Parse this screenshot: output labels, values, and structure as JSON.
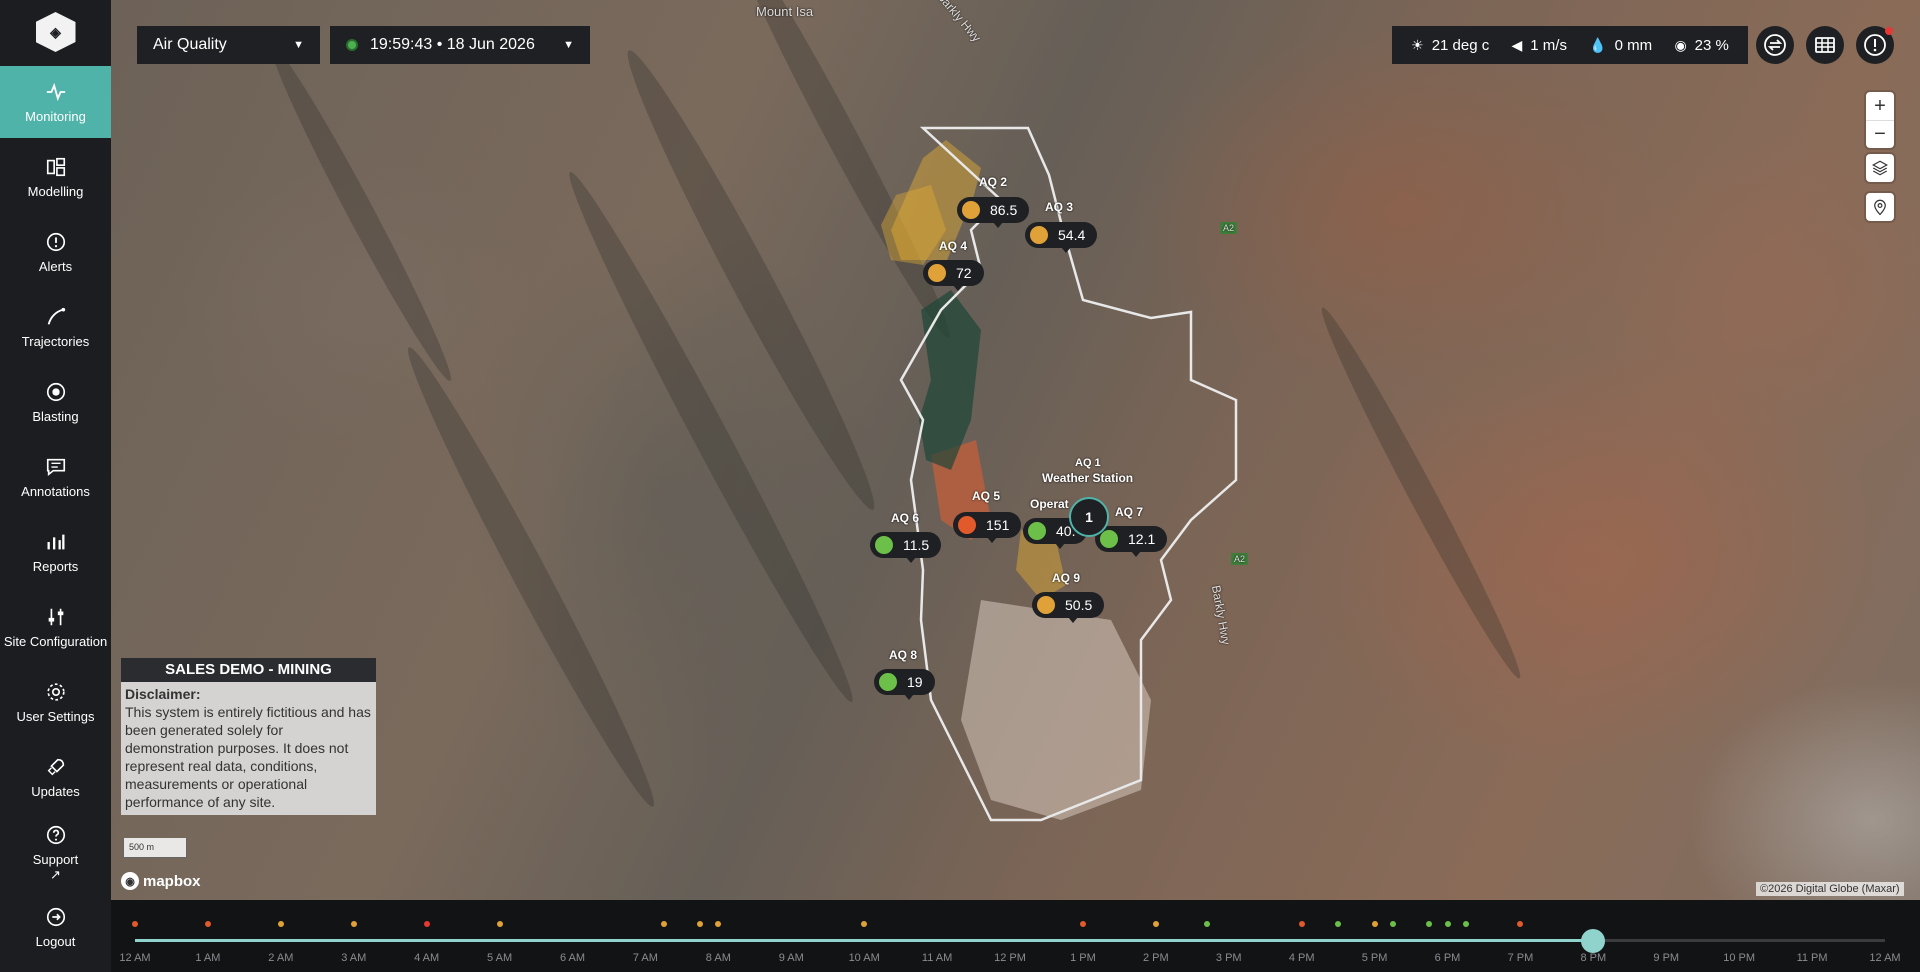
{
  "app": {
    "logo_icon": "pulse-hexagon-icon"
  },
  "sidebar": {
    "items": [
      {
        "label": "Monitoring",
        "icon": "pulse-icon",
        "active": true
      },
      {
        "label": "Modelling",
        "icon": "chart-blocks-icon",
        "active": false
      },
      {
        "label": "Alerts",
        "icon": "alert-circle-icon",
        "active": false
      },
      {
        "label": "Trajectories",
        "icon": "trajectory-icon",
        "active": false
      },
      {
        "label": "Blasting",
        "icon": "target-icon",
        "active": false
      },
      {
        "label": "Annotations",
        "icon": "comment-icon",
        "active": false
      },
      {
        "label": "Reports",
        "icon": "bar-chart-icon",
        "active": false
      },
      {
        "label": "Site Configuration",
        "icon": "sliders-icon",
        "active": false
      },
      {
        "label": "User Settings",
        "icon": "gear-icon",
        "active": false
      },
      {
        "label": "Updates",
        "icon": "rocket-icon",
        "active": false
      },
      {
        "label": "Support",
        "icon": "help-circle-icon",
        "active": false
      },
      {
        "label": "Logout",
        "icon": "logout-icon",
        "active": false
      }
    ]
  },
  "toolbar": {
    "layer_select": "Air Quality",
    "time_select": "19:59:43 • 18 Jun 2026"
  },
  "weather": {
    "temperature": "21 deg c",
    "wind": "1 m/s",
    "rain": "0 mm",
    "humidity": "23 %"
  },
  "map": {
    "place_labels": [
      "Mount Isa",
      "Barkly Hwy",
      "Barkly Hwy"
    ],
    "road_signs": [
      "A2",
      "A2"
    ],
    "sensors": [
      {
        "name": "AQ 2",
        "value": "86.5",
        "status_color": "#e0a238"
      },
      {
        "name": "AQ 3",
        "value": "54.4",
        "status_color": "#e0a238"
      },
      {
        "name": "AQ 4",
        "value": "72",
        "status_color": "#e0a238"
      },
      {
        "name": "AQ 5",
        "value": "151",
        "status_color": "#e25a2c"
      },
      {
        "name": "AQ 6",
        "value": "11.5",
        "status_color": "#6cc04a"
      },
      {
        "name": "Operat",
        "value": "40.",
        "status_color": "#6cc04a"
      },
      {
        "name": "AQ 7",
        "value": "12.1",
        "status_color": "#6cc04a"
      },
      {
        "name": "AQ 9",
        "value": "50.5",
        "status_color": "#e0a238"
      },
      {
        "name": "AQ 8",
        "value": "19",
        "status_color": "#6cc04a"
      }
    ],
    "weather_station": {
      "name": "Weather Station",
      "cluster_count": "1",
      "hidden_label": "AQ 1"
    },
    "scale": "500 m",
    "attribution": "©2026 Digital Globe (Maxar)",
    "mapbox": "mapbox"
  },
  "disclaimer": {
    "header": "SALES DEMO - MINING",
    "title": "Disclaimer:",
    "text": "This system is entirely fictitious and has been generated solely for demonstration purposes. It does not represent real data, conditions, measurements or operational performance of any site."
  },
  "timeline": {
    "labels": [
      "12 AM",
      "1 AM",
      "2 AM",
      "3 AM",
      "4 AM",
      "5 AM",
      "6 AM",
      "7 AM",
      "8 AM",
      "9 AM",
      "10 AM",
      "11 AM",
      "12 PM",
      "1 PM",
      "2 PM",
      "3 PM",
      "4 PM",
      "5 PM",
      "6 PM",
      "7 PM",
      "8 PM",
      "9 PM",
      "10 PM",
      "11 PM",
      "12 AM"
    ],
    "current_position": 0.833,
    "event_colors": {
      "warning": "#e0a238",
      "danger": "#e25a2c",
      "critical": "#e53935",
      "ok": "#6cc04a"
    },
    "events": [
      {
        "hour": 0.0,
        "level": "danger"
      },
      {
        "hour": 1.0,
        "level": "danger"
      },
      {
        "hour": 2.0,
        "level": "warning"
      },
      {
        "hour": 3.0,
        "level": "warning"
      },
      {
        "hour": 4.0,
        "level": "critical"
      },
      {
        "hour": 5.0,
        "level": "warning"
      },
      {
        "hour": 7.25,
        "level": "warning"
      },
      {
        "hour": 7.75,
        "level": "warning"
      },
      {
        "hour": 8.0,
        "level": "warning"
      },
      {
        "hour": 10.0,
        "level": "warning"
      },
      {
        "hour": 13.0,
        "level": "danger"
      },
      {
        "hour": 14.0,
        "level": "warning"
      },
      {
        "hour": 14.7,
        "level": "ok"
      },
      {
        "hour": 16.0,
        "level": "danger"
      },
      {
        "hour": 16.5,
        "level": "ok"
      },
      {
        "hour": 17.0,
        "level": "warning"
      },
      {
        "hour": 17.25,
        "level": "ok"
      },
      {
        "hour": 17.75,
        "level": "ok"
      },
      {
        "hour": 18.0,
        "level": "ok"
      },
      {
        "hour": 18.25,
        "level": "ok"
      },
      {
        "hour": 19.0,
        "level": "danger"
      }
    ]
  }
}
